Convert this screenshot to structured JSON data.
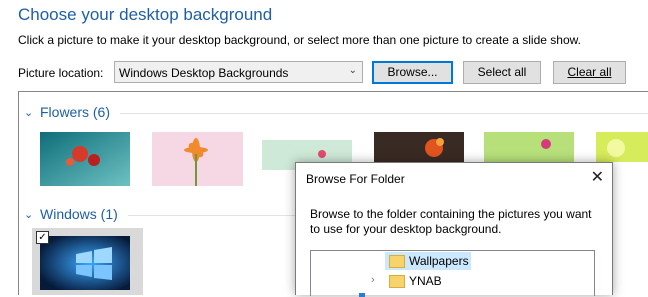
{
  "header": {
    "title": "Choose your desktop background",
    "description": "Click a picture to make it your desktop background, or select more than one picture to create a slide show."
  },
  "location": {
    "label": "Picture location:",
    "selected": "Windows Desktop Backgrounds",
    "browse_label": "Browse...",
    "select_all_label": "Select all",
    "clear_all_label": "Clear all"
  },
  "groups": [
    {
      "title": "Flowers (6)"
    },
    {
      "title": "Windows (1)"
    }
  ],
  "dialog": {
    "title": "Browse For Folder",
    "close_glyph": "✕",
    "description": "Browse to the folder containing the pictures you want to use for your desktop background.",
    "tree_items": [
      {
        "label": "Wallpapers",
        "selected": true
      },
      {
        "label": "YNAB",
        "selected": false
      }
    ]
  },
  "colors": {
    "accent": "#1e5fa8",
    "selection": "#cce8ff"
  }
}
